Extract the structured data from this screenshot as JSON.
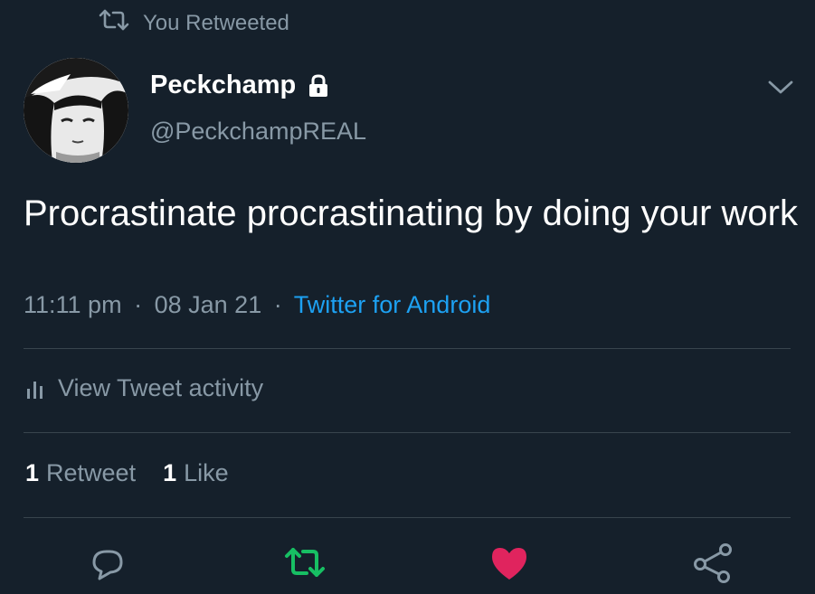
{
  "header": {
    "retweet_context": "You Retweeted",
    "retweet_icon": "retweet-icon"
  },
  "author": {
    "display_name": "Peckchamp",
    "handle": "@PeckchampREAL",
    "protected_icon": "lock-icon",
    "avatar_icon": "avatar-image"
  },
  "tweet": {
    "text": "Procrastinate procrastinating by doing your work",
    "time": "11:11 pm",
    "date": "08 Jan 21",
    "source": "Twitter for Android",
    "separator": "·"
  },
  "activity": {
    "label": "View Tweet activity",
    "icon": "bar-chart-icon"
  },
  "stats": {
    "retweets_count": "1",
    "retweets_label": "Retweet",
    "likes_count": "1",
    "likes_label": "Like"
  },
  "actions": {
    "reply_icon": "reply-icon",
    "retweet_icon": "retweet-icon",
    "like_icon": "heart-icon",
    "share_icon": "share-icon"
  },
  "colors": {
    "background": "#15202b",
    "text_primary": "#ffffff",
    "text_secondary": "#8899a6",
    "link": "#1da1f2",
    "retweet_active": "#17bf63",
    "like_active": "#e0245e",
    "divider": "#38444d"
  }
}
